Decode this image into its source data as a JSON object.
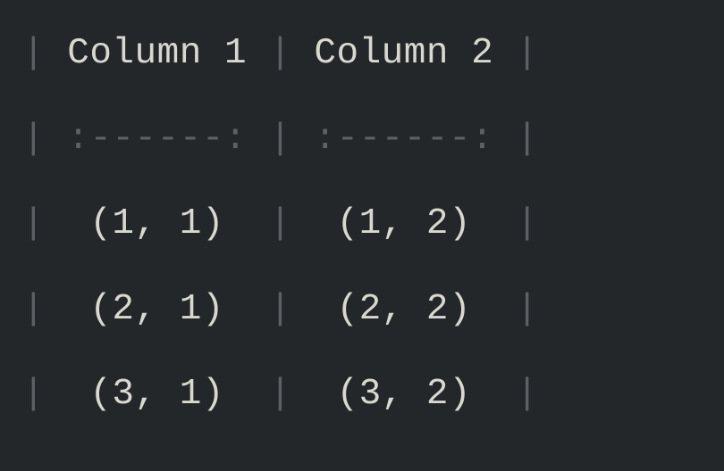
{
  "table": {
    "headers": [
      "Column 1",
      "Column 2"
    ],
    "separator": [
      ":------:",
      ":------:"
    ],
    "rows": [
      [
        "(1, 1)",
        "(1, 2)"
      ],
      [
        "(2, 1)",
        "(2, 2)"
      ],
      [
        "(3, 1)",
        "(3, 2)"
      ]
    ]
  },
  "display": {
    "line1_pipe1": "|",
    "line1_h1": " Column 1 ",
    "line1_pipe2": "|",
    "line1_h2": " Column 2 ",
    "line1_pipe3": "|",
    "line2_pipe1": "|",
    "line2_s1": " :------: ",
    "line2_pipe2": "|",
    "line2_s2": " :------: ",
    "line2_pipe3": "|",
    "line3_pipe1": "|",
    "line3_c1": "  (1, 1)  ",
    "line3_pipe2": "|",
    "line3_c2": "  (1, 2)  ",
    "line3_pipe3": "|",
    "line4_pipe1": "|",
    "line4_c1": "  (2, 1)  ",
    "line4_pipe2": "|",
    "line4_c2": "  (2, 2)  ",
    "line4_pipe3": "|",
    "line5_pipe1": "|",
    "line5_c1": "  (3, 1)  ",
    "line5_pipe2": "|",
    "line5_c2": "  (3, 2)  ",
    "line5_pipe3": "|"
  },
  "chart_data": {
    "type": "table",
    "title": "",
    "columns": [
      "Column 1",
      "Column 2"
    ],
    "rows": [
      [
        "(1, 1)",
        "(1, 2)"
      ],
      [
        "(2, 1)",
        "(2, 2)"
      ],
      [
        "(3, 1)",
        "(3, 2)"
      ]
    ]
  }
}
